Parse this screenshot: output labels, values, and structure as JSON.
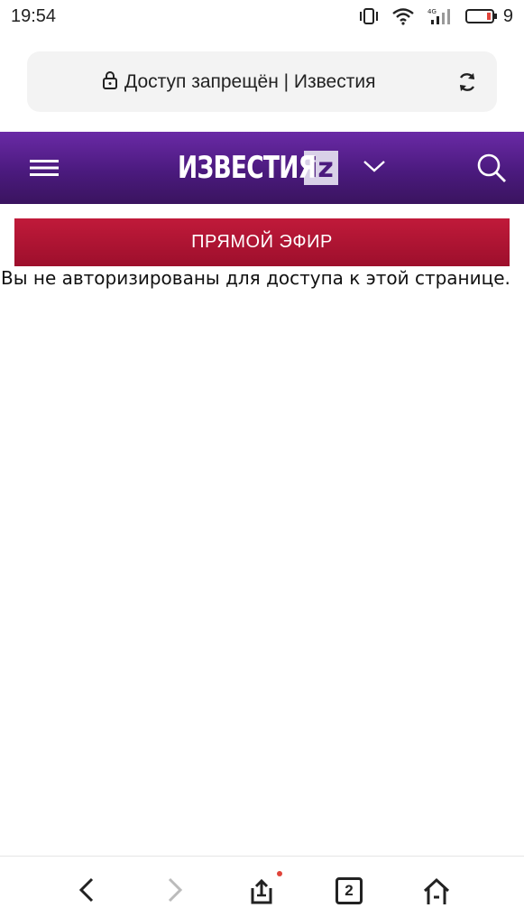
{
  "status_bar": {
    "time": "19:54",
    "battery_level": "9",
    "icons": [
      "vibrate-icon",
      "wifi-icon",
      "signal-4g-icon",
      "battery-icon"
    ]
  },
  "browser": {
    "page_title": "Доступ запрещён | Известия",
    "lock_icon": "lock-icon",
    "reload_icon": "reload-icon"
  },
  "site": {
    "logo_text": "ИЗВЕСТИЯ",
    "logo_badge": "iz",
    "brand_color": "#4b1a7e",
    "menu_icon": "hamburger-menu-icon",
    "dropdown_icon": "chevron-down-icon",
    "search_icon": "search-icon"
  },
  "live_button": {
    "label": "ПРЯМОЙ ЭФИР",
    "color": "#b0163a"
  },
  "message": "Вы не авторизированы для доступа к этой странице.",
  "bottom_nav": {
    "tabs_count": "2",
    "items": [
      "back-icon",
      "forward-icon",
      "share-icon",
      "tabs-icon",
      "home-icon"
    ]
  }
}
